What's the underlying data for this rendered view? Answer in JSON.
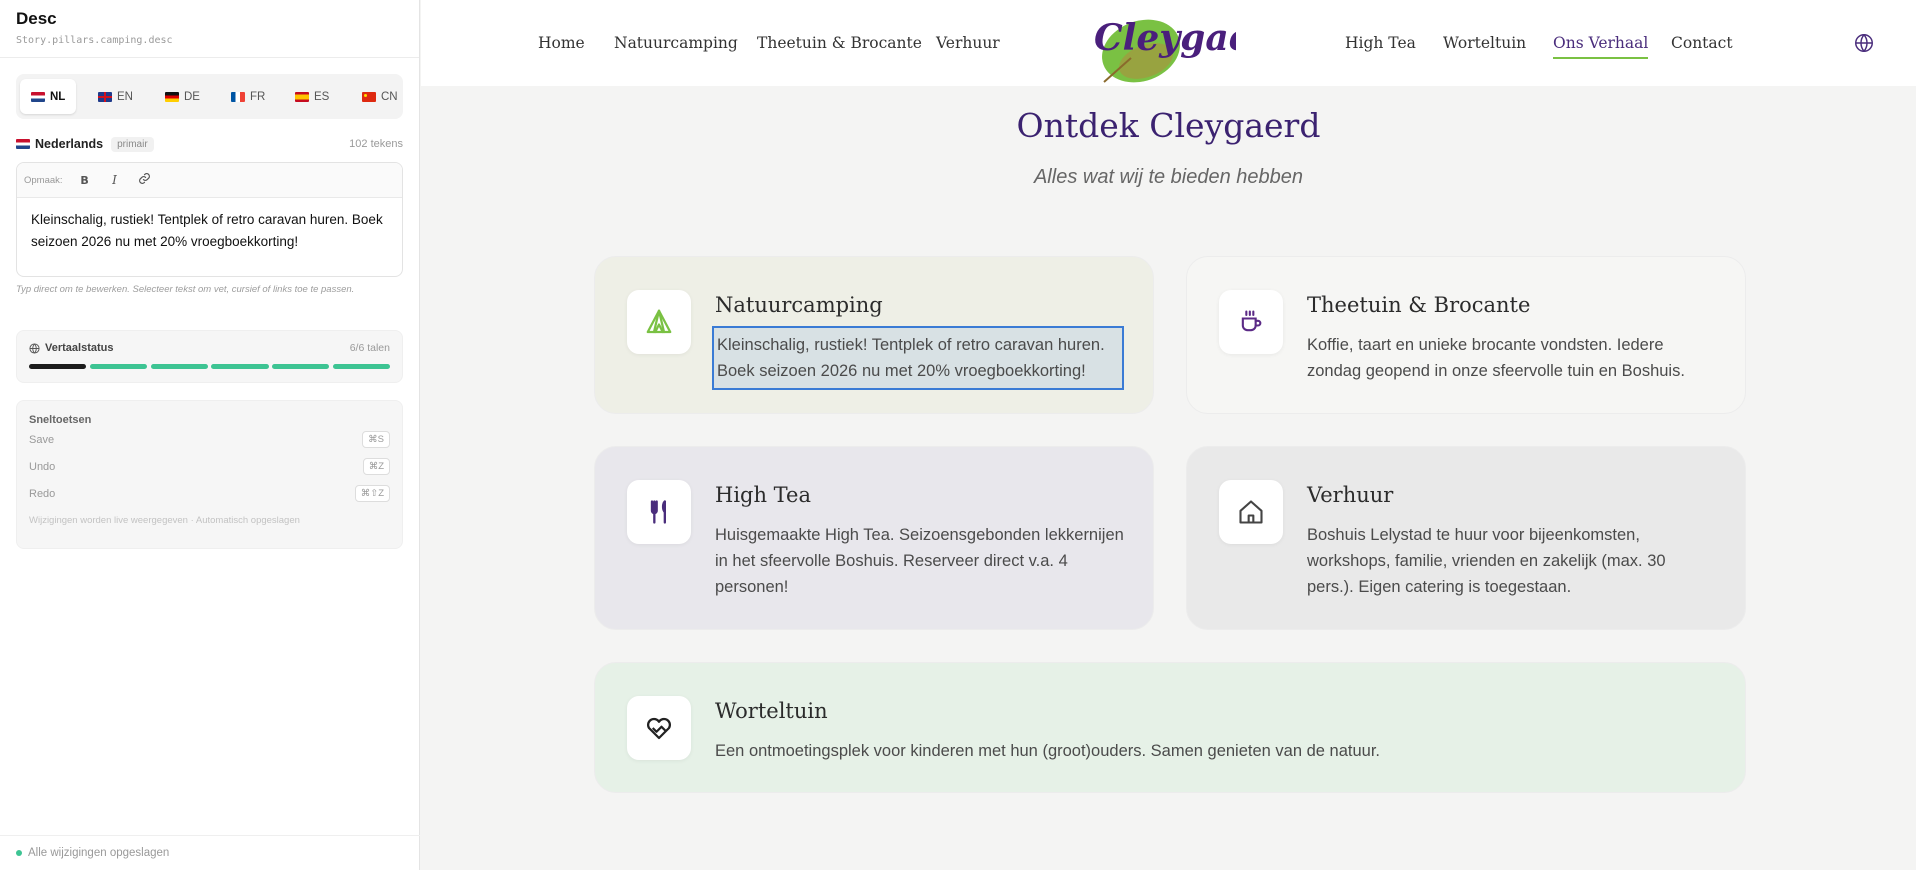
{
  "editor": {
    "title": "Desc",
    "key": "Story.pillars.camping.desc",
    "languages": [
      {
        "code": "NL",
        "flag": "flag-nl",
        "active": true
      },
      {
        "code": "EN",
        "flag": "flag-en"
      },
      {
        "code": "DE",
        "flag": "flag-de"
      },
      {
        "code": "FR",
        "flag": "flag-fr"
      },
      {
        "code": "ES",
        "flag": "flag-es"
      },
      {
        "code": "CN",
        "flag": "flag-cn"
      }
    ],
    "current_language": "Nederlands",
    "primary_badge": "primair",
    "char_count": "102 tekens",
    "toolbar_label": "Opmaak:",
    "text": "Kleinschalig, rustiek! Tentplek of retro caravan huren. Boek seizoen 2026 nu met 20% vroegboekkorting!",
    "hint": "Typ direct om te bewerken. Selecteer tekst om vet, cursief of links toe te passen.",
    "status": {
      "title": "Vertaalstatus",
      "count": "6/6 talen",
      "progress": 1.0
    },
    "shortcuts": {
      "title": "Sneltoetsen",
      "items": [
        {
          "label": "Save",
          "key": "⌘S"
        },
        {
          "label": "Undo",
          "key": "⌘Z"
        },
        {
          "label": "Redo",
          "key": "⌘⇧Z"
        }
      ],
      "note": "Wijzigingen worden live weergegeven · Automatisch opgeslagen"
    },
    "footer": "Alle wijzigingen opgeslagen"
  },
  "site": {
    "nav_left": [
      "Home",
      "Natuurcamping",
      "Theetuin & Brocante",
      "Verhuur"
    ],
    "nav_right": [
      "High Tea",
      "Worteltuin",
      "Ons Verhaal",
      "Contact"
    ],
    "logo_text": "Cleygaerd",
    "hero_title": "Ontdek Cleygaerd",
    "hero_subtitle": "Alles wat wij te bieden hebben",
    "cards": [
      {
        "title": "Natuurcamping",
        "text": "Kleinschalig, rustiek! Tentplek of retro caravan huren. Boek seizoen 2026 nu met 20% vroegboekkorting!",
        "icon": "tent-icon"
      },
      {
        "title": "Theetuin & Brocante",
        "text": "Koffie, taart en unieke brocante vondsten. Iedere zondag geopend in onze sfeervolle tuin en Boshuis.",
        "icon": "coffee-cup-icon"
      },
      {
        "title": "High Tea",
        "text": "Huisgemaakte High Tea. Seizoensgebonden lekkernijen in het sfeervolle Boshuis. Reserveer direct v.a. 4 personen!",
        "icon": "cutlery-icon"
      },
      {
        "title": "Verhuur",
        "text": "Boshuis Lelystad te huur voor bijeenkomsten, workshops, familie, vrienden en zakelijk (max. 30 pers.). Eigen catering is toegestaan.",
        "icon": "house-icon"
      },
      {
        "title": "Worteltuin",
        "text": "Een ontmoetingsplek voor kinderen met hun (groot)ouders. Samen genieten van de natuur.",
        "icon": "heart-hands-icon"
      }
    ],
    "colors": {
      "brand_purple": "#3b2270",
      "brand_green": "#7ac143",
      "selection_blue": "#3a7bd5",
      "status_green": "#3dc493"
    }
  }
}
